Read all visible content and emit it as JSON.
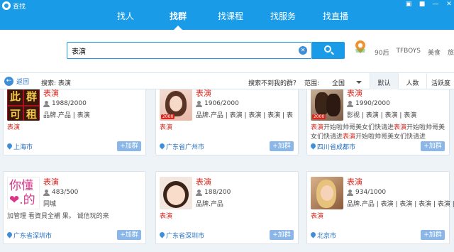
{
  "window": {
    "title": "查找"
  },
  "nav": {
    "tabs": [
      {
        "label": "找人",
        "active": false
      },
      {
        "label": "找群",
        "active": true
      },
      {
        "label": "找课程",
        "active": false
      },
      {
        "label": "找服务",
        "active": false
      },
      {
        "label": "找直播",
        "active": false
      }
    ]
  },
  "search": {
    "value": "表演",
    "hot_tags": [
      "90后",
      "TFBOYS",
      "美食",
      "旅游"
    ]
  },
  "filter": {
    "back_label": "返回",
    "search_keyword": "搜索: 表演",
    "not_found_text": "搜索不到我的群？",
    "scope_label": "范围:",
    "scope_value": "全国",
    "sort_tabs": [
      "默认",
      "人数",
      "活跃度"
    ],
    "sort_active": "默认"
  },
  "results": [
    {
      "name": "表演",
      "members": "1988/2000",
      "tags": "品牌.产品 | 表演",
      "desc": "表演",
      "desc_red": true,
      "location": "上海市",
      "avatar_text": [
        "此",
        "群",
        "可",
        "租"
      ],
      "join_label": "+加群"
    },
    {
      "name": "表演",
      "members": "1906/2000",
      "tags": "品牌.产品 | 表演 | 表演 | 表演 | 表",
      "desc": "表演",
      "desc_red": true,
      "location": "广东省广州市",
      "avatar_badge": "2000",
      "join_label": "+加群"
    },
    {
      "name": "表演",
      "members": "1990/2000",
      "tags": "影视 | 表演 | 表演 | 表演",
      "desc_parts": [
        {
          "text": "表演",
          "red": true
        },
        {
          "text": "开始啦帅哥美女们快请进",
          "red": false
        },
        {
          "text": "表演",
          "red": true
        },
        {
          "text": "开始啦帅哥美女们快请进",
          "red": false
        },
        {
          "text": "表演",
          "red": true
        },
        {
          "text": "开始啦帅哥美女们快请进",
          "red": false
        }
      ],
      "location": "四川省成都市",
      "avatar_badge": "2000",
      "join_label": "+加群"
    },
    {
      "name": "表演",
      "members": "483/500",
      "tags": "同城",
      "desc": "加管理 看資貝全補 果。 诚信玩的来",
      "desc_red": false,
      "location": "广东省深圳市",
      "avatar_text": [
        "你懂",
        "❤.的"
      ],
      "join_label": "+加群"
    },
    {
      "name": "表演",
      "members": "188/200",
      "tags": "品牌.产品",
      "desc": "表演",
      "desc_red": true,
      "location": "广东省深圳市",
      "join_label": "+加群"
    },
    {
      "name": "表演",
      "members": "934/1000",
      "tags": "品牌.产品 | 表演 | 表演 | 表演 | 表演 | 表",
      "desc": "表演",
      "desc_red": true,
      "location": "北京市",
      "join_label": "+加群"
    }
  ]
}
